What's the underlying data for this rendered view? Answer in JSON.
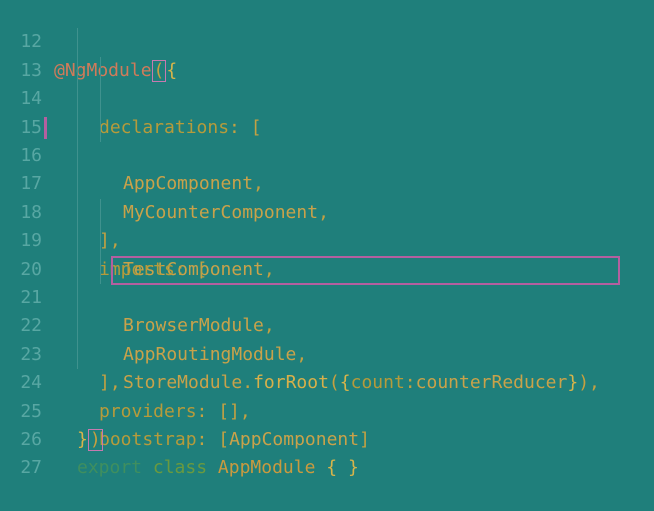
{
  "lines": [
    {
      "num": "12",
      "tokens": [
        "@NgModule",
        "(",
        "{"
      ]
    },
    {
      "num": "13",
      "tokens": [
        "declarations",
        ": ["
      ]
    },
    {
      "num": "14",
      "tokens": [
        "AppComponent",
        ","
      ]
    },
    {
      "num": "15",
      "tokens": [
        "MyCounterComponent",
        ","
      ]
    },
    {
      "num": "16",
      "tokens": [
        "TestComponent",
        ","
      ]
    },
    {
      "num": "17",
      "tokens": [
        "],"
      ]
    },
    {
      "num": "18",
      "tokens": [
        "imports",
        ": ["
      ]
    },
    {
      "num": "19",
      "tokens": [
        "BrowserModule",
        ","
      ]
    },
    {
      "num": "20",
      "tokens": [
        "AppRoutingModule",
        ","
      ]
    },
    {
      "num": "21",
      "tokens": [
        "StoreModule",
        ".",
        "forRoot",
        "(",
        "{",
        "count",
        ":",
        "counterReducer",
        "}",
        ")",
        ","
      ]
    },
    {
      "num": "22",
      "tokens": [
        "],"
      ]
    },
    {
      "num": "23",
      "tokens": [
        "providers",
        ": [],"
      ]
    },
    {
      "num": "24",
      "tokens": [
        "bootstrap",
        ": [",
        "AppComponent",
        "]"
      ]
    },
    {
      "num": "25",
      "tokens": [
        "}",
        ")"
      ]
    },
    {
      "num": "26",
      "tokens": [
        "export",
        " ",
        "class",
        " ",
        "AppModule",
        " { }"
      ]
    },
    {
      "num": "27",
      "tokens": []
    }
  ],
  "colors": {
    "background": "#1f7f7b",
    "git_modified_bar": "#b45fa0",
    "highlight_border": "#b45fa0"
  }
}
